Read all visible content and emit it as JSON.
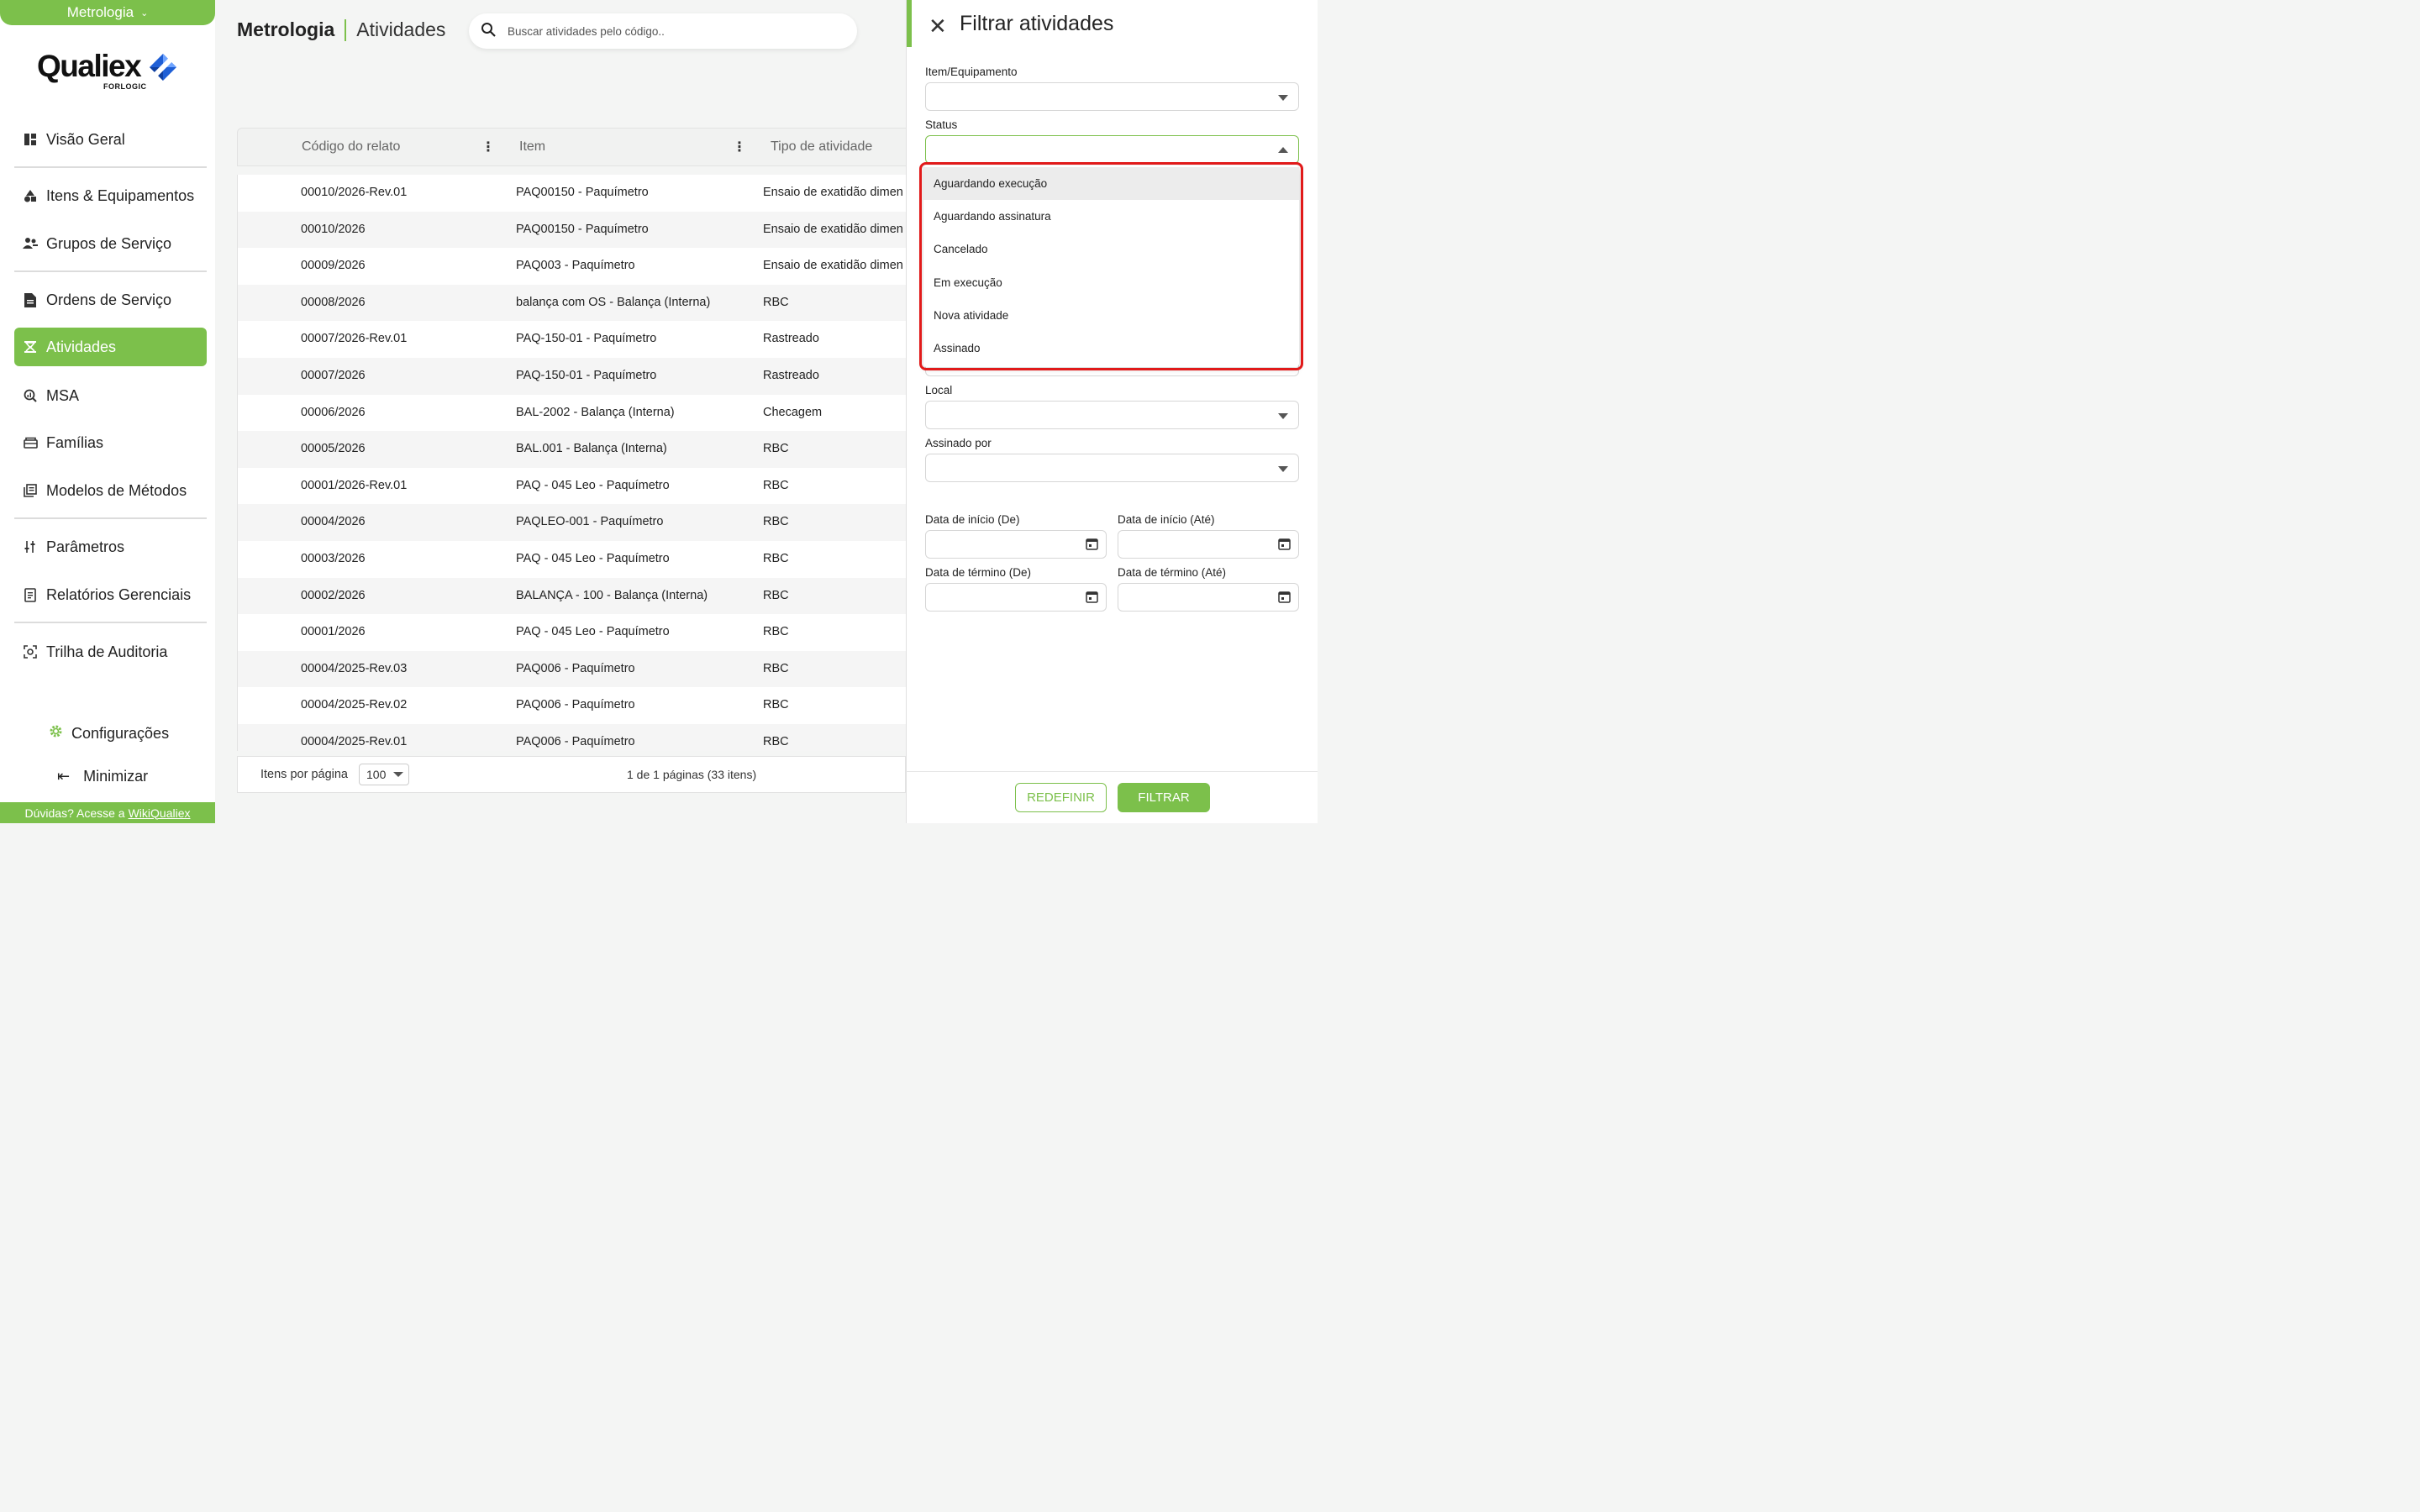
{
  "sidebar": {
    "app_switch": "Metrologia",
    "logo_text": "Qualiex",
    "logo_sub": "FORLOGIC",
    "items": [
      {
        "label": "Visão Geral",
        "icon": "dashboard-icon"
      },
      {
        "label": "Itens & Equipamentos",
        "icon": "shapes-icon"
      },
      {
        "label": "Grupos de Serviço",
        "icon": "group-icon"
      },
      {
        "label": "Ordens de Serviço",
        "icon": "document-icon"
      },
      {
        "label": "Atividades",
        "icon": "activities-icon",
        "active": true
      },
      {
        "label": "MSA",
        "icon": "analysis-icon"
      },
      {
        "label": "Famílias",
        "icon": "folder-icon"
      },
      {
        "label": "Modelos de Métodos",
        "icon": "library-icon"
      },
      {
        "label": "Parâmetros",
        "icon": "sliders-icon"
      },
      {
        "label": "Relatórios Gerenciais",
        "icon": "report-icon"
      },
      {
        "label": "Trilha de Auditoria",
        "icon": "audit-icon"
      }
    ],
    "settings_label": "Configurações",
    "minimize_label": "Minimizar",
    "help_text": "Dúvidas? Acesse a",
    "help_link": "WikiQualiex"
  },
  "header": {
    "module": "Metrologia",
    "page": "Atividades",
    "search_placeholder": "Buscar atividades pelo código.."
  },
  "table": {
    "columns": [
      "Código do relato",
      "Item",
      "Tipo de atividade"
    ],
    "rows": [
      [
        "00010/2026-Rev.01",
        "PAQ00150 - Paquímetro",
        "Ensaio de exatidão dimen"
      ],
      [
        "00010/2026",
        "PAQ00150 - Paquímetro",
        "Ensaio de exatidão dimen"
      ],
      [
        "00009/2026",
        "PAQ003 - Paquímetro",
        "Ensaio de exatidão dimen"
      ],
      [
        "00008/2026",
        "balança com OS - Balança (Interna)",
        "RBC"
      ],
      [
        "00007/2026-Rev.01",
        "PAQ-150-01 - Paquímetro",
        "Rastreado"
      ],
      [
        "00007/2026",
        "PAQ-150-01 - Paquímetro",
        "Rastreado"
      ],
      [
        "00006/2026",
        "BAL-2002 - Balança (Interna)",
        "Checagem"
      ],
      [
        "00005/2026",
        "BAL.001 - Balança (Interna)",
        "RBC"
      ],
      [
        "00001/2026-Rev.01",
        "PAQ - 045 Leo - Paquímetro",
        "RBC"
      ],
      [
        "00004/2026",
        "PAQLEO-001 - Paquímetro",
        "RBC"
      ],
      [
        "00003/2026",
        "PAQ - 045 Leo - Paquímetro",
        "RBC"
      ],
      [
        "00002/2026",
        "BALANÇA - 100 - Balança (Interna)",
        "RBC"
      ],
      [
        "00001/2026",
        "PAQ - 045 Leo - Paquímetro",
        "RBC"
      ],
      [
        "00004/2025-Rev.03",
        "PAQ006 - Paquímetro",
        "RBC"
      ],
      [
        "00004/2025-Rev.02",
        "PAQ006 - Paquímetro",
        "RBC"
      ],
      [
        "00004/2025-Rev.01",
        "PAQ006 - Paquímetro",
        "RBC"
      ]
    ],
    "items_per_page_label": "Itens por página",
    "items_per_page_value": "100",
    "pagination": "1 de 1 páginas (33 itens)"
  },
  "filter_panel": {
    "title": "Filtrar atividades",
    "item_label": "Item/Equipamento",
    "status_label": "Status",
    "status_options": [
      "Aguardando execução",
      "Aguardando assinatura",
      "Cancelado",
      "Em execução",
      "Nova atividade",
      "Assinado"
    ],
    "local_label": "Local",
    "signed_by_label": "Assinado por",
    "start_from_label": "Data de início (De)",
    "start_to_label": "Data de início (Até)",
    "end_from_label": "Data de término (De)",
    "end_to_label": "Data de término (Até)",
    "reset_label": "REDEFINIR",
    "filter_label": "FILTRAR"
  },
  "colors": {
    "accent": "#7cc04b",
    "highlight_outline": "#e11a1a"
  }
}
